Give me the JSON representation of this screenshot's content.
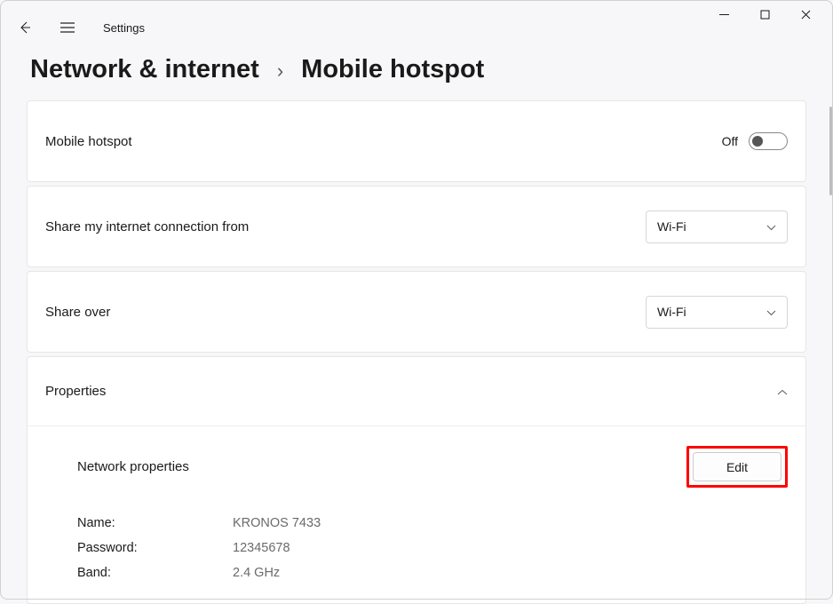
{
  "window": {
    "app_title": "Settings"
  },
  "breadcrumb": {
    "parent": "Network & internet",
    "separator": "›",
    "current": "Mobile hotspot"
  },
  "hotspot_toggle": {
    "label": "Mobile hotspot",
    "state_text": "Off"
  },
  "share_from": {
    "label": "Share my internet connection from",
    "value": "Wi-Fi"
  },
  "share_over": {
    "label": "Share over",
    "value": "Wi-Fi"
  },
  "properties": {
    "header": "Properties",
    "section_title": "Network properties",
    "edit_label": "Edit",
    "name_label": "Name:",
    "name_value": "KRONOS 7433",
    "password_label": "Password:",
    "password_value": "12345678",
    "band_label": "Band:",
    "band_value": "2.4 GHz"
  }
}
